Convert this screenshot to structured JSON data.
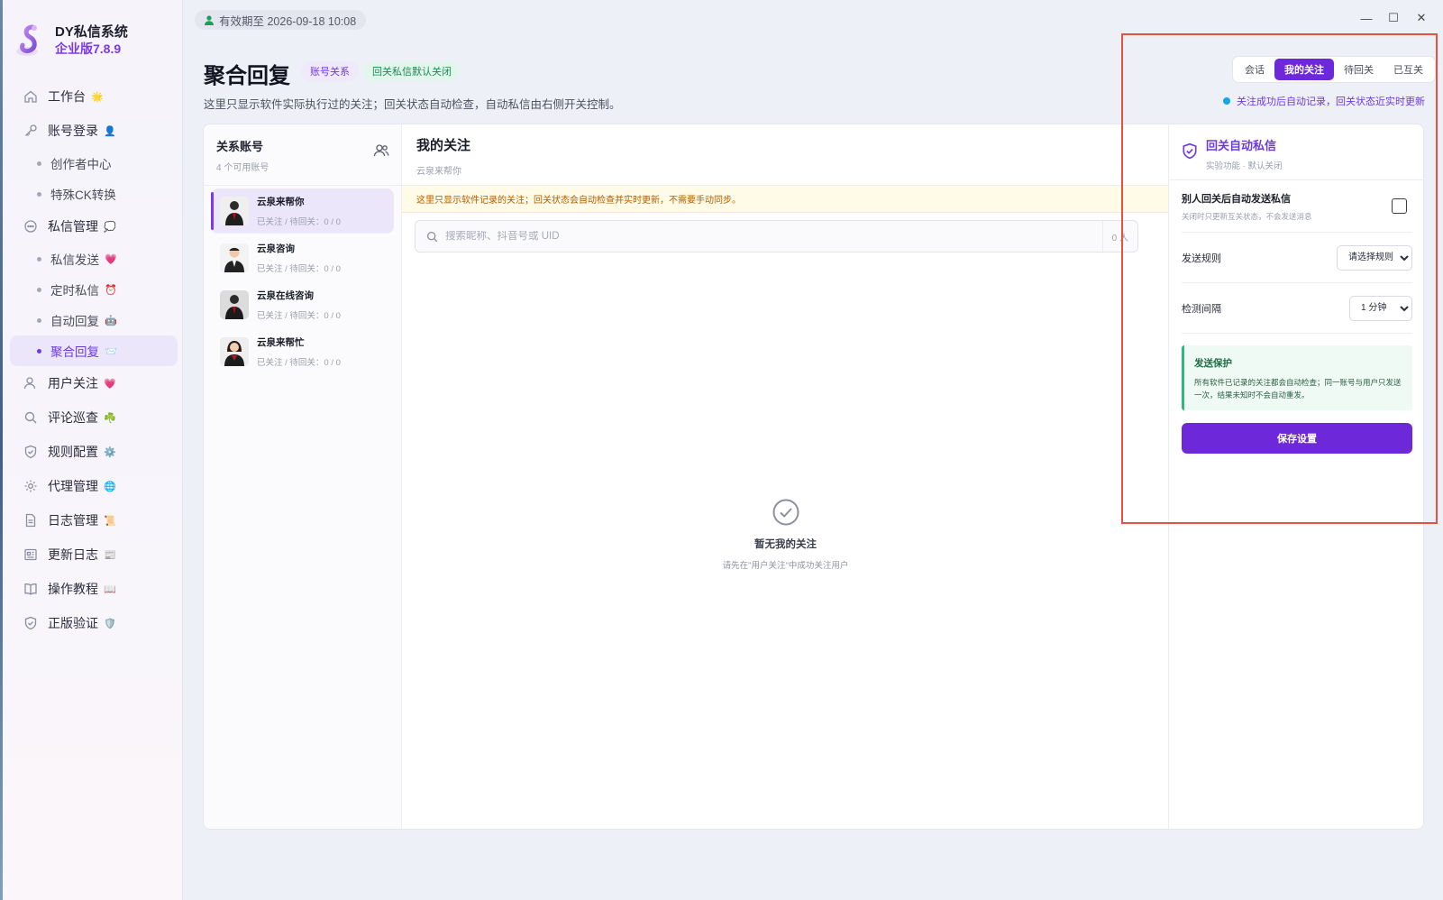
{
  "app": {
    "name": "DY私信系统",
    "version": "企业版7.8.9"
  },
  "topbar": {
    "expiry": "有效期至 2026-09-18 10:08"
  },
  "window_controls": {
    "minimize": "—",
    "maximize": "☐",
    "close": "✕"
  },
  "sidebar": {
    "workbench": {
      "label": "工作台",
      "emoji": "🌟"
    },
    "account_login": {
      "label": "账号登录",
      "emoji": "👤"
    },
    "creator_center": {
      "label": "创作者中心"
    },
    "ck_convert": {
      "label": "特殊CK转换"
    },
    "dm_manage": {
      "label": "私信管理",
      "emoji": "💭"
    },
    "dm_send": {
      "label": "私信发送",
      "emoji": "💗"
    },
    "scheduled_dm": {
      "label": "定时私信",
      "emoji": "⏰"
    },
    "auto_reply": {
      "label": "自动回复",
      "emoji": "🤖"
    },
    "aggregate_reply": {
      "label": "聚合回复",
      "emoji": "📨"
    },
    "user_follow": {
      "label": "用户关注",
      "emoji": "💗"
    },
    "comment_patrol": {
      "label": "评论巡查",
      "emoji": "☘️"
    },
    "rule_config": {
      "label": "规则配置",
      "emoji": "⚙️"
    },
    "proxy_manage": {
      "label": "代理管理",
      "emoji": "🌐"
    },
    "log_manage": {
      "label": "日志管理",
      "emoji": "📜"
    },
    "changelog": {
      "label": "更新日志",
      "emoji": "📰"
    },
    "tutorial": {
      "label": "操作教程",
      "emoji": "📖"
    },
    "license_verify": {
      "label": "正版验证",
      "emoji": "🛡️"
    }
  },
  "header": {
    "title": "聚合回复",
    "badge_account": "账号关系",
    "badge_followback": "回关私信默认关闭",
    "description": "这里只显示软件实际执行过的关注；回关状态自动检查，自动私信由右侧开关控制。"
  },
  "tabs": [
    {
      "label": "会话",
      "active": false
    },
    {
      "label": "我的关注",
      "active": true
    },
    {
      "label": "待回关",
      "active": false
    },
    {
      "label": "已互关",
      "active": false
    }
  ],
  "status_note": "关注成功后自动记录，回关状态近实时更新",
  "accounts_panel": {
    "title": "关系账号",
    "subtitle": "4 个可用账号",
    "items": [
      {
        "name": "云泉来帮你",
        "meta": "已关注 / 待回关：0 / 0",
        "active": true
      },
      {
        "name": "云泉咨询",
        "meta": "已关注 / 待回关：0 / 0",
        "active": false
      },
      {
        "name": "云泉在线咨询",
        "meta": "已关注 / 待回关：0 / 0",
        "active": false
      },
      {
        "name": "云泉来帮忙",
        "meta": "已关注 / 待回关：0 / 0",
        "active": false
      }
    ]
  },
  "follows_panel": {
    "title": "我的关注",
    "subtitle": "云泉来帮你",
    "warning": "这里只显示软件记录的关注；回关状态会自动检查并实时更新，不需要手动同步。",
    "search_placeholder": "搜索昵称、抖音号或 UID",
    "count": "0 人",
    "empty_title": "暂无我的关注",
    "empty_subtitle": "请先在\"用户关注\"中成功关注用户"
  },
  "auto_dm_panel": {
    "title": "回关自动私信",
    "subtitle": "实验功能 · 默认关闭",
    "toggle_label": "别人回关后自动发送私信",
    "toggle_hint": "关闭时只更新互关状态，不会发送消息",
    "toggle_checked": false,
    "rule_label": "发送规则",
    "rule_selected": "请选择规则",
    "interval_label": "检测间隔",
    "interval_selected": "1 分钟",
    "protect_title": "发送保护",
    "protect_text": "所有软件已记录的关注都会自动检查；同一账号与用户只发送一次，结果未知时不会自动重发。",
    "save_label": "保存设置"
  },
  "colors": {
    "accent": "#6d28d9",
    "highlight_outline": "#e8503f",
    "success": "#2fb877"
  }
}
